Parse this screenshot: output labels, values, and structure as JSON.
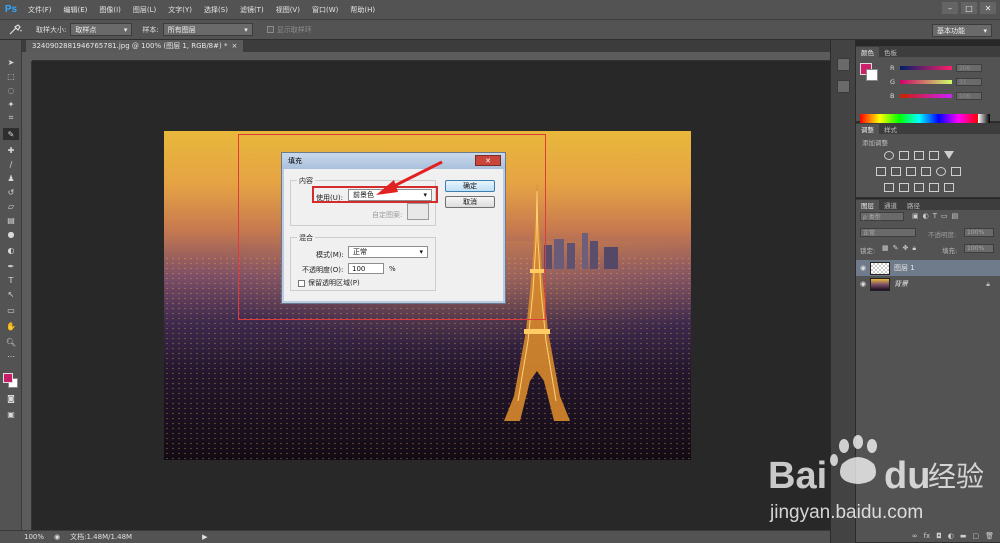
{
  "app": {
    "logo": "Ps"
  },
  "menu": [
    "文件(F)",
    "编辑(E)",
    "图像(I)",
    "图层(L)",
    "文字(Y)",
    "选择(S)",
    "滤镜(T)",
    "视图(V)",
    "窗口(W)",
    "帮助(H)"
  ],
  "window_controls": [
    "–",
    "□",
    "✕"
  ],
  "options": {
    "sample_size_label": "取样大小:",
    "sample_size_value": "取样点",
    "sample_label": "样本:",
    "sample_value": "所有图层",
    "show_ring_label": "显示取样环",
    "workspace": "基本功能"
  },
  "document": {
    "tab": "3240902881946765781.jpg @ 100% (图层 1, RGB/8#) *",
    "tab_close": "×"
  },
  "dialog": {
    "title": "填充",
    "close": "✕",
    "contents_legend": "内容",
    "use_label": "使用(U):",
    "use_value": "前景色",
    "custom_pattern_label": "自定图案:",
    "ok": "确定",
    "cancel": "取消",
    "blending_legend": "混合",
    "mode_label": "模式(M):",
    "mode_value": "正常",
    "opacity_label": "不透明度(O):",
    "opacity_value": "100",
    "opacity_unit": "%",
    "preserve_label": "保留透明区域(P)"
  },
  "status": {
    "zoom": "100%",
    "doc": "文档:1.48M/1.48M"
  },
  "color_panel": {
    "tabs": [
      "颜色",
      "色板"
    ],
    "channels": [
      {
        "label": "R",
        "value": "206"
      },
      {
        "label": "G",
        "value": "31"
      },
      {
        "label": "B",
        "value": "106"
      }
    ],
    "foreground": "#ce1f6a"
  },
  "adjust_panel": {
    "tabs": [
      "调整",
      "样式"
    ],
    "add_label": "添加调整"
  },
  "layers_panel": {
    "tabs": [
      "图层",
      "通道",
      "路径"
    ],
    "kind_label": "ρ 类型",
    "mode_value": "正常",
    "opacity_label": "不透明度:",
    "opacity_value": "100%",
    "lock_label": "锁定:",
    "fill_label": "填充:",
    "fill_value": "100%",
    "layers": [
      {
        "name": "图层 1",
        "selected": true
      },
      {
        "name": "背景",
        "selected": false,
        "locked": true
      }
    ]
  },
  "watermark": {
    "brand": "Bai",
    "brand2": "du",
    "cn": "经验",
    "url": "jingyan.baidu.com"
  }
}
